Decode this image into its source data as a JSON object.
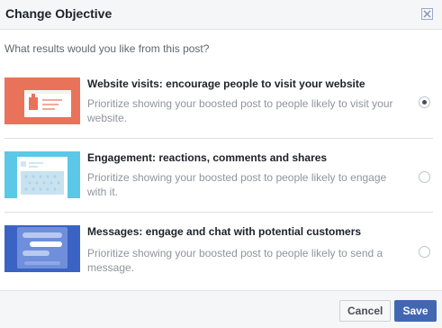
{
  "dialog": {
    "title": "Change Objective",
    "question": "What results would you like from this post?"
  },
  "options": [
    {
      "title": "Website visits: encourage people to visit your website",
      "description": "Prioritize showing your boosted post to people likely to visit your website.",
      "selected": true,
      "thumbnail_icon": "website-illustration"
    },
    {
      "title": "Engagement: reactions, comments and shares",
      "description": "Prioritize showing your boosted post to people likely to engage with it.",
      "selected": false,
      "thumbnail_icon": "engagement-illustration"
    },
    {
      "title": "Messages: engage and chat with potential customers",
      "description": "Prioritize showing your boosted post to people likely to send a message.",
      "selected": false,
      "thumbnail_icon": "messages-illustration"
    }
  ],
  "footer": {
    "cancel_label": "Cancel",
    "save_label": "Save"
  },
  "colors": {
    "accent": "#4267b2",
    "website_thumb": "#e9735a",
    "engagement_thumb": "#5bc8e8",
    "messages_thumb": "#3b63c4"
  }
}
